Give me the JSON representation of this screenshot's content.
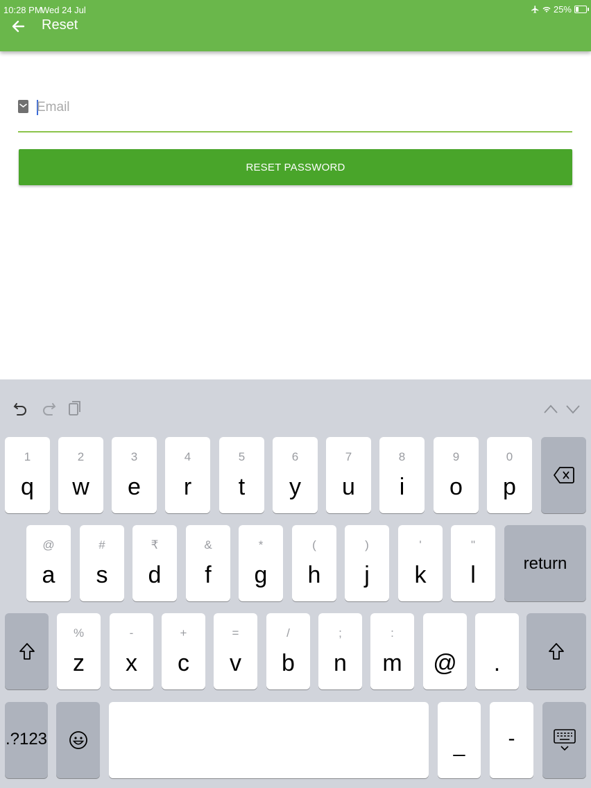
{
  "status_bar": {
    "time": "10:28 PM",
    "date": "Wed 24 Jul",
    "battery": "25%"
  },
  "header": {
    "title": "Reset",
    "back_icon": "arrow-left-icon"
  },
  "form": {
    "email_placeholder": "Email",
    "email_value": "",
    "reset_label": "RESET PASSWORD"
  },
  "keyboard": {
    "row1": [
      {
        "sub": "1",
        "main": "q"
      },
      {
        "sub": "2",
        "main": "w"
      },
      {
        "sub": "3",
        "main": "e"
      },
      {
        "sub": "4",
        "main": "r"
      },
      {
        "sub": "5",
        "main": "t"
      },
      {
        "sub": "6",
        "main": "y"
      },
      {
        "sub": "7",
        "main": "u"
      },
      {
        "sub": "8",
        "main": "i"
      },
      {
        "sub": "9",
        "main": "o"
      },
      {
        "sub": "0",
        "main": "p"
      }
    ],
    "row2": [
      {
        "sub": "@",
        "main": "a"
      },
      {
        "sub": "#",
        "main": "s"
      },
      {
        "sub": "₹",
        "main": "d"
      },
      {
        "sub": "&",
        "main": "f"
      },
      {
        "sub": "*",
        "main": "g"
      },
      {
        "sub": "(",
        "main": "h"
      },
      {
        "sub": ")",
        "main": "j"
      },
      {
        "sub": "'",
        "main": "k"
      },
      {
        "sub": "\"",
        "main": "l"
      }
    ],
    "row3": [
      {
        "sub": "%",
        "main": "z"
      },
      {
        "sub": "-",
        "main": "x"
      },
      {
        "sub": "+",
        "main": "c"
      },
      {
        "sub": "=",
        "main": "v"
      },
      {
        "sub": "/",
        "main": "b"
      },
      {
        "sub": ";",
        "main": "n"
      },
      {
        "sub": ":",
        "main": "m"
      },
      {
        "sub": "",
        "main": "@"
      },
      {
        "sub": "",
        "main": "."
      }
    ],
    "return_label": "return",
    "numbers_label": ".?123",
    "underscore_label": "_",
    "dash_label": "-"
  }
}
